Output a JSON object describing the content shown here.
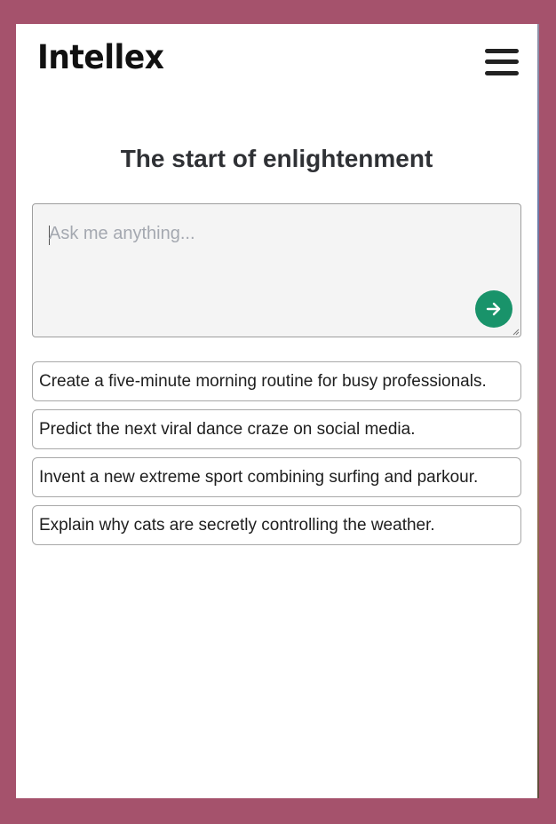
{
  "header": {
    "logo_text": "Intellex",
    "menu_icon": "hamburger-menu-icon"
  },
  "main": {
    "heading": "The start of enlightenment",
    "prompt": {
      "value": "",
      "placeholder": "Ask me anything...",
      "submit_icon": "arrow-right-icon",
      "submit_color": "#19936a"
    },
    "suggestions": [
      {
        "label": "Create a five-minute morning routine for busy professionals."
      },
      {
        "label": "Predict the next viral dance craze on social media."
      },
      {
        "label": "Invent a new extreme sport combining surfing and parkour."
      },
      {
        "label": "Explain why cats are secretly controlling the weather."
      }
    ]
  },
  "colors": {
    "backdrop": "#a5526c",
    "accent": "#19936a"
  }
}
